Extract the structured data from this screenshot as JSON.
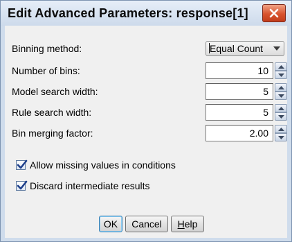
{
  "window": {
    "title": "Edit Advanced Parameters: response[1]"
  },
  "fields": {
    "binning_method": {
      "label": "Binning method:",
      "value": "Equal Count"
    },
    "number_of_bins": {
      "label": "Number of bins:",
      "value": "10"
    },
    "model_search_width": {
      "label": "Model search width:",
      "value": "5"
    },
    "rule_search_width": {
      "label": "Rule search width:",
      "value": "5"
    },
    "bin_merging_factor": {
      "label": "Bin merging factor:",
      "value": "2.00"
    }
  },
  "checkboxes": {
    "allow_missing": {
      "label": "Allow missing values in conditions",
      "checked": true
    },
    "discard_intermediate": {
      "label": "Discard intermediate results",
      "checked": true
    }
  },
  "buttons": {
    "ok": "OK",
    "cancel": "Cancel",
    "help_mnemonic": "H",
    "help_rest": "elp"
  },
  "icons": {
    "close": "close-icon",
    "dropdown": "chevron-down-icon",
    "spin_up": "spin-up-icon",
    "spin_down": "spin-down-icon",
    "check": "checkmark-icon"
  },
  "colors": {
    "title_bar": "#cddaeb",
    "close_button": "#d8532e",
    "dialog_background": "#f0f0f0",
    "checkmark": "#1d3e8a"
  }
}
